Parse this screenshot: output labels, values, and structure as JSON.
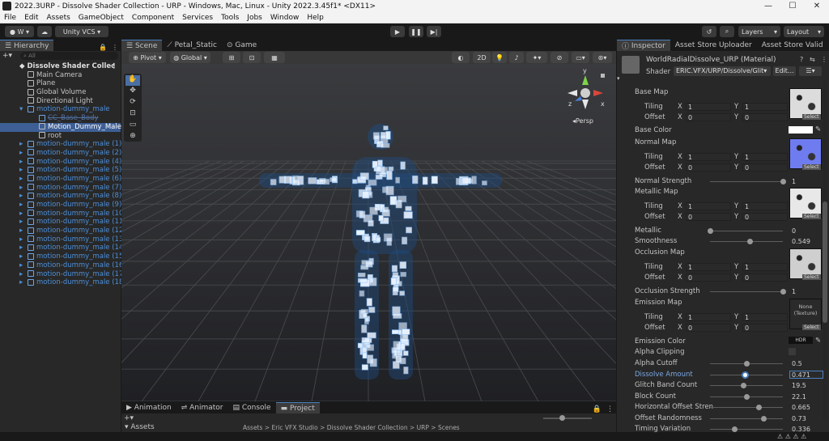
{
  "window": {
    "title": "2022.3URP - Dissolve Shader Collection - URP - Windows, Mac, Linux - Unity 2022.3.45f1* <DX11>"
  },
  "menu": [
    "File",
    "Edit",
    "Assets",
    "GameObject",
    "Component",
    "Services",
    "Tools",
    "Jobs",
    "Window",
    "Help"
  ],
  "toolbar": {
    "account": "W",
    "vcs": "Unity VCS",
    "layers": "Layers",
    "layout": "Layout"
  },
  "hierarchy": {
    "tab": "Hierarchy",
    "search_placeholder": "All",
    "scene": "Dissolve Shader Collec",
    "items": [
      {
        "label": "Main Camera",
        "depth": 1,
        "style": "normal"
      },
      {
        "label": "Plane",
        "depth": 1,
        "style": "normal"
      },
      {
        "label": "Global Volume",
        "depth": 1,
        "style": "normal"
      },
      {
        "label": "Directional Light",
        "depth": 1,
        "style": "normal"
      },
      {
        "label": "motion-dummy_male",
        "depth": 1,
        "style": "blue"
      },
      {
        "label": "CC_Base_Body",
        "depth": 2,
        "style": "dim"
      },
      {
        "label": "Motion_Dummy_Male",
        "depth": 2,
        "style": "selected"
      },
      {
        "label": "root",
        "depth": 2,
        "style": "normal"
      },
      {
        "label": "motion-dummy_male (1)",
        "depth": 1,
        "style": "blue"
      },
      {
        "label": "motion-dummy_male (2)",
        "depth": 1,
        "style": "blue"
      },
      {
        "label": "motion-dummy_male (4)",
        "depth": 1,
        "style": "blue"
      },
      {
        "label": "motion-dummy_male (5)",
        "depth": 1,
        "style": "blue"
      },
      {
        "label": "motion-dummy_male (6)",
        "depth": 1,
        "style": "blue"
      },
      {
        "label": "motion-dummy_male (7)",
        "depth": 1,
        "style": "blue"
      },
      {
        "label": "motion-dummy_male (8)",
        "depth": 1,
        "style": "blue"
      },
      {
        "label": "motion-dummy_male (9)",
        "depth": 1,
        "style": "blue"
      },
      {
        "label": "motion-dummy_male (10)",
        "depth": 1,
        "style": "blue"
      },
      {
        "label": "motion-dummy_male (11)",
        "depth": 1,
        "style": "blue"
      },
      {
        "label": "motion-dummy_male (12)",
        "depth": 1,
        "style": "blue"
      },
      {
        "label": "motion-dummy_male (13)",
        "depth": 1,
        "style": "blue"
      },
      {
        "label": "motion-dummy_male (14)",
        "depth": 1,
        "style": "blue"
      },
      {
        "label": "motion-dummy_male (15)",
        "depth": 1,
        "style": "blue"
      },
      {
        "label": "motion-dummy_male (16)",
        "depth": 1,
        "style": "blue"
      },
      {
        "label": "motion-dummy_male (17)",
        "depth": 1,
        "style": "blue"
      },
      {
        "label": "motion-dummy_male (18)",
        "depth": 1,
        "style": "blue"
      }
    ]
  },
  "scene": {
    "tabs": [
      "Scene",
      "Petal_Static",
      "Game"
    ],
    "pivot": "Pivot",
    "global": "Global",
    "mode2d": "2D",
    "persp": "Persp",
    "gizmo_axes": {
      "x": "x",
      "y": "y",
      "z": "z"
    }
  },
  "bottom": {
    "tabs": [
      "Animation",
      "Animator",
      "Console",
      "Project"
    ],
    "assets": "Assets",
    "path": "Assets > Eric VFX Studio > Dissolve Shader Collection > URP > Scenes"
  },
  "inspector": {
    "tabs": [
      "Inspector",
      "Asset Store Uploader",
      "Asset Store Valid"
    ],
    "material": "WorldRadialDissolve_URP (Material)",
    "shader_label": "Shader",
    "shader_value": "ERIC.VFX/URP/Dissolve/Glit",
    "edit": "Edit...",
    "labels": {
      "tiling": "Tiling",
      "offset": "Offset",
      "x": "X",
      "y": "Y",
      "select": "Select",
      "hdr": "HDR",
      "none": "None",
      "texture": "(Texture)"
    },
    "tex_maps": [
      {
        "name": "Base Map",
        "tiling": [
          "1",
          "1"
        ],
        "offset": [
          "0",
          "0"
        ]
      },
      {
        "name": "Normal Map",
        "tiling": [
          "1",
          "1"
        ],
        "offset": [
          "0",
          "0"
        ]
      },
      {
        "name": "Metallic Map",
        "tiling": [
          "1",
          "1"
        ],
        "offset": [
          "0",
          "0"
        ]
      },
      {
        "name": "Occlusion Map",
        "tiling": [
          "1",
          "1"
        ],
        "offset": [
          "0",
          "0"
        ]
      },
      {
        "name": "Emission Map",
        "tiling": [
          "1",
          "1"
        ],
        "offset": [
          "0",
          "0"
        ]
      }
    ],
    "base_color": "Base Color",
    "normal_strength": {
      "label": "Normal Strength",
      "value": "1",
      "level": 1.0
    },
    "metallic": {
      "label": "Metallic",
      "value": "0",
      "level": 0.0
    },
    "smoothness": {
      "label": "Smoothness",
      "value": "0.549",
      "level": 0.549
    },
    "occlusion_strength": {
      "label": "Occlusion Strength",
      "value": "1",
      "level": 1.0
    },
    "emission_color": "Emission Color",
    "alpha_clipping": "Alpha Clipping",
    "props": [
      {
        "label": "Alpha Cutoff",
        "value": "0.5",
        "level": 0.5,
        "active": false
      },
      {
        "label": "Dissolve Amount",
        "value": "0.471",
        "level": 0.471,
        "active": true
      },
      {
        "label": "Glitch Band Count",
        "value": "19.5",
        "level": 0.45,
        "active": false
      },
      {
        "label": "Block Count",
        "value": "22.1",
        "level": 0.5,
        "active": false
      },
      {
        "label": "Horizontal Offset Stren",
        "value": "0.665",
        "level": 0.665,
        "active": false
      },
      {
        "label": "Offset Randomness",
        "value": "0.73",
        "level": 0.73,
        "active": false
      },
      {
        "label": "Timing Variation",
        "value": "0.336",
        "level": 0.336,
        "active": false
      }
    ]
  },
  "colors": {
    "accent": "#4a80c0",
    "selected_row": "#3e5f96",
    "blue_text": "#4d8fd8"
  }
}
